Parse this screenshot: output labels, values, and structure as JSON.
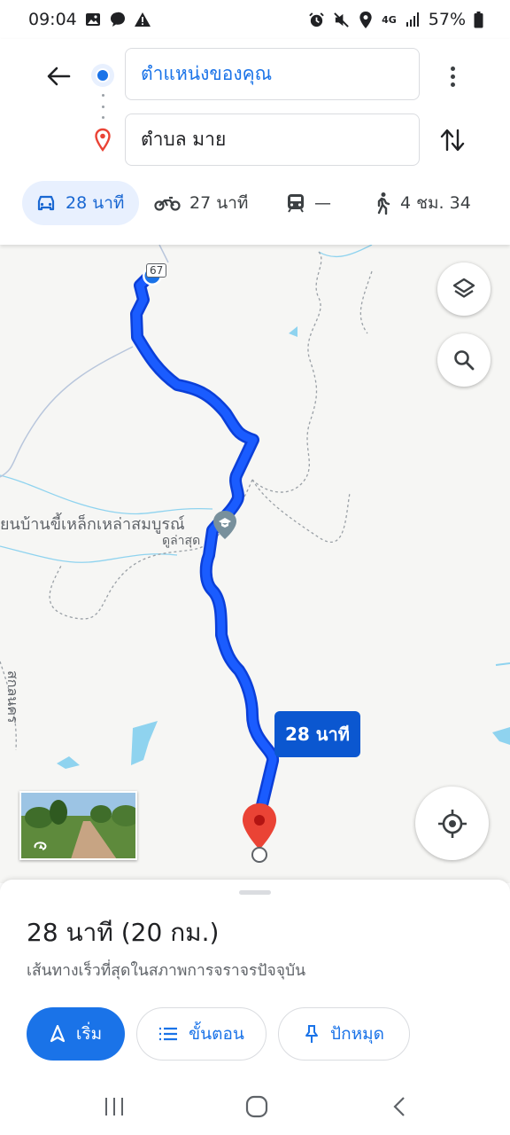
{
  "status_bar": {
    "time": "09:04",
    "network": "4G",
    "battery": "57%",
    "left_icons": [
      "gallery-icon",
      "message-bubble-icon",
      "warning-icon"
    ],
    "right_icons": [
      "alarm-icon",
      "mute-icon",
      "location-icon",
      "signal-icon",
      "battery-icon"
    ]
  },
  "header": {
    "origin": "ตำแหน่งของคุณ",
    "destination": "ตำบล มาย",
    "modes": [
      {
        "icon": "car-icon",
        "label": "28 นาที",
        "selected": true
      },
      {
        "icon": "motorcycle-icon",
        "label": "27 นาที",
        "selected": false
      },
      {
        "icon": "transit-icon",
        "label": "—",
        "selected": false
      },
      {
        "icon": "walk-icon",
        "label": "4 ชม. 34",
        "selected": false
      }
    ]
  },
  "map": {
    "road_number": "67",
    "poi_name": "ยนบ้านขี้เหล็กเหล่าสมบูรณ์",
    "poi_subtitle": "ดูล่าสุด",
    "vertical_label": "สกลนคร",
    "route_time_label": "28 นาที",
    "route_color": "#1a5cff"
  },
  "summary": {
    "title": "28 นาที (20 กม.)",
    "subtitle": "เส้นทางเร็วที่สุดในสภาพการจราจรปัจจุบัน",
    "buttons": {
      "start": "เริ่ม",
      "steps": "ขั้นตอน",
      "pin": "ปักหมุด"
    }
  },
  "colors": {
    "accent": "#1a73e8",
    "route": "#1a5cff",
    "destination_pin": "#ea4335"
  }
}
